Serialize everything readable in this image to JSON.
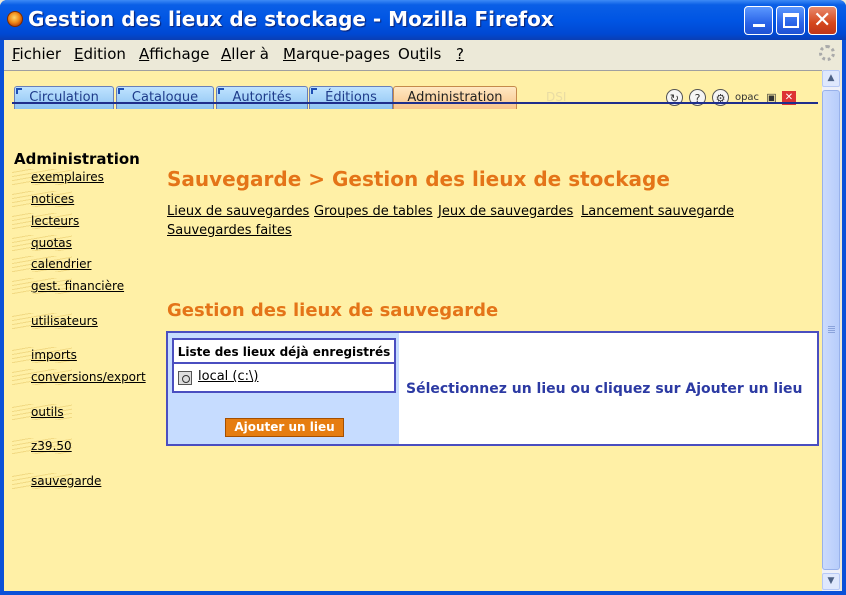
{
  "window": {
    "title": "Gestion des lieux de stockage - Mozilla Firefox"
  },
  "menubar": {
    "items": [
      {
        "label": "Fichier",
        "ul": "F",
        "rest": "ichier"
      },
      {
        "label": "Edition",
        "ul": "E",
        "rest": "dition"
      },
      {
        "label": "Affichage",
        "ul": "A",
        "rest": "ffichage"
      },
      {
        "label": "Aller à",
        "ul": "A",
        "rest": "ller à"
      },
      {
        "label": "Marque-pages",
        "ul": "M",
        "rest": "arque-pages"
      },
      {
        "label": "Outils",
        "pre": "Ou",
        "ul": "t",
        "rest": "ils"
      },
      {
        "label": "?",
        "ul": "?",
        "rest": ""
      }
    ]
  },
  "tabs": {
    "items": [
      "Circulation",
      "Catalogue",
      "Autorités",
      "Éditions",
      "Administration"
    ],
    "active": "Administration",
    "ghost": "DSI"
  },
  "toolbar_icons": [
    "refresh-icon",
    "help-icon",
    "settings-icon",
    "opac-icon",
    "save-icon",
    "close-icon"
  ],
  "toolbar_labels": {
    "help": "?",
    "opac": "opac",
    "close": "✕"
  },
  "sidebar": {
    "title": "Administration",
    "items": [
      "exemplaires",
      "notices",
      "lecteurs",
      "quotas",
      "calendrier",
      "gest. financière",
      "utilisateurs",
      "imports",
      "conversions/export",
      "outils",
      "z39.50",
      "sauvegarde"
    ]
  },
  "main": {
    "title": "Sauvegarde > Gestion des lieux de stockage",
    "links": [
      "Lieux de sauvegardes",
      "Groupes de tables",
      "Jeux de sauvegardes",
      "Lancement sauvegarde",
      "Sauvegardes faites"
    ],
    "section_title": "Gestion des lieux de sauvegarde",
    "list_header": "Liste des lieux déjà enregistrés",
    "list_items": [
      "local (c:\\)"
    ],
    "add_button": "Ajouter un lieu",
    "message": "Sélectionnez un lieu ou cliquez sur Ajouter un lieu"
  },
  "colors": {
    "background": "#fff0a6",
    "heading": "#e47418",
    "accent_blue": "#4a4ec0",
    "button": "#e67d10"
  }
}
